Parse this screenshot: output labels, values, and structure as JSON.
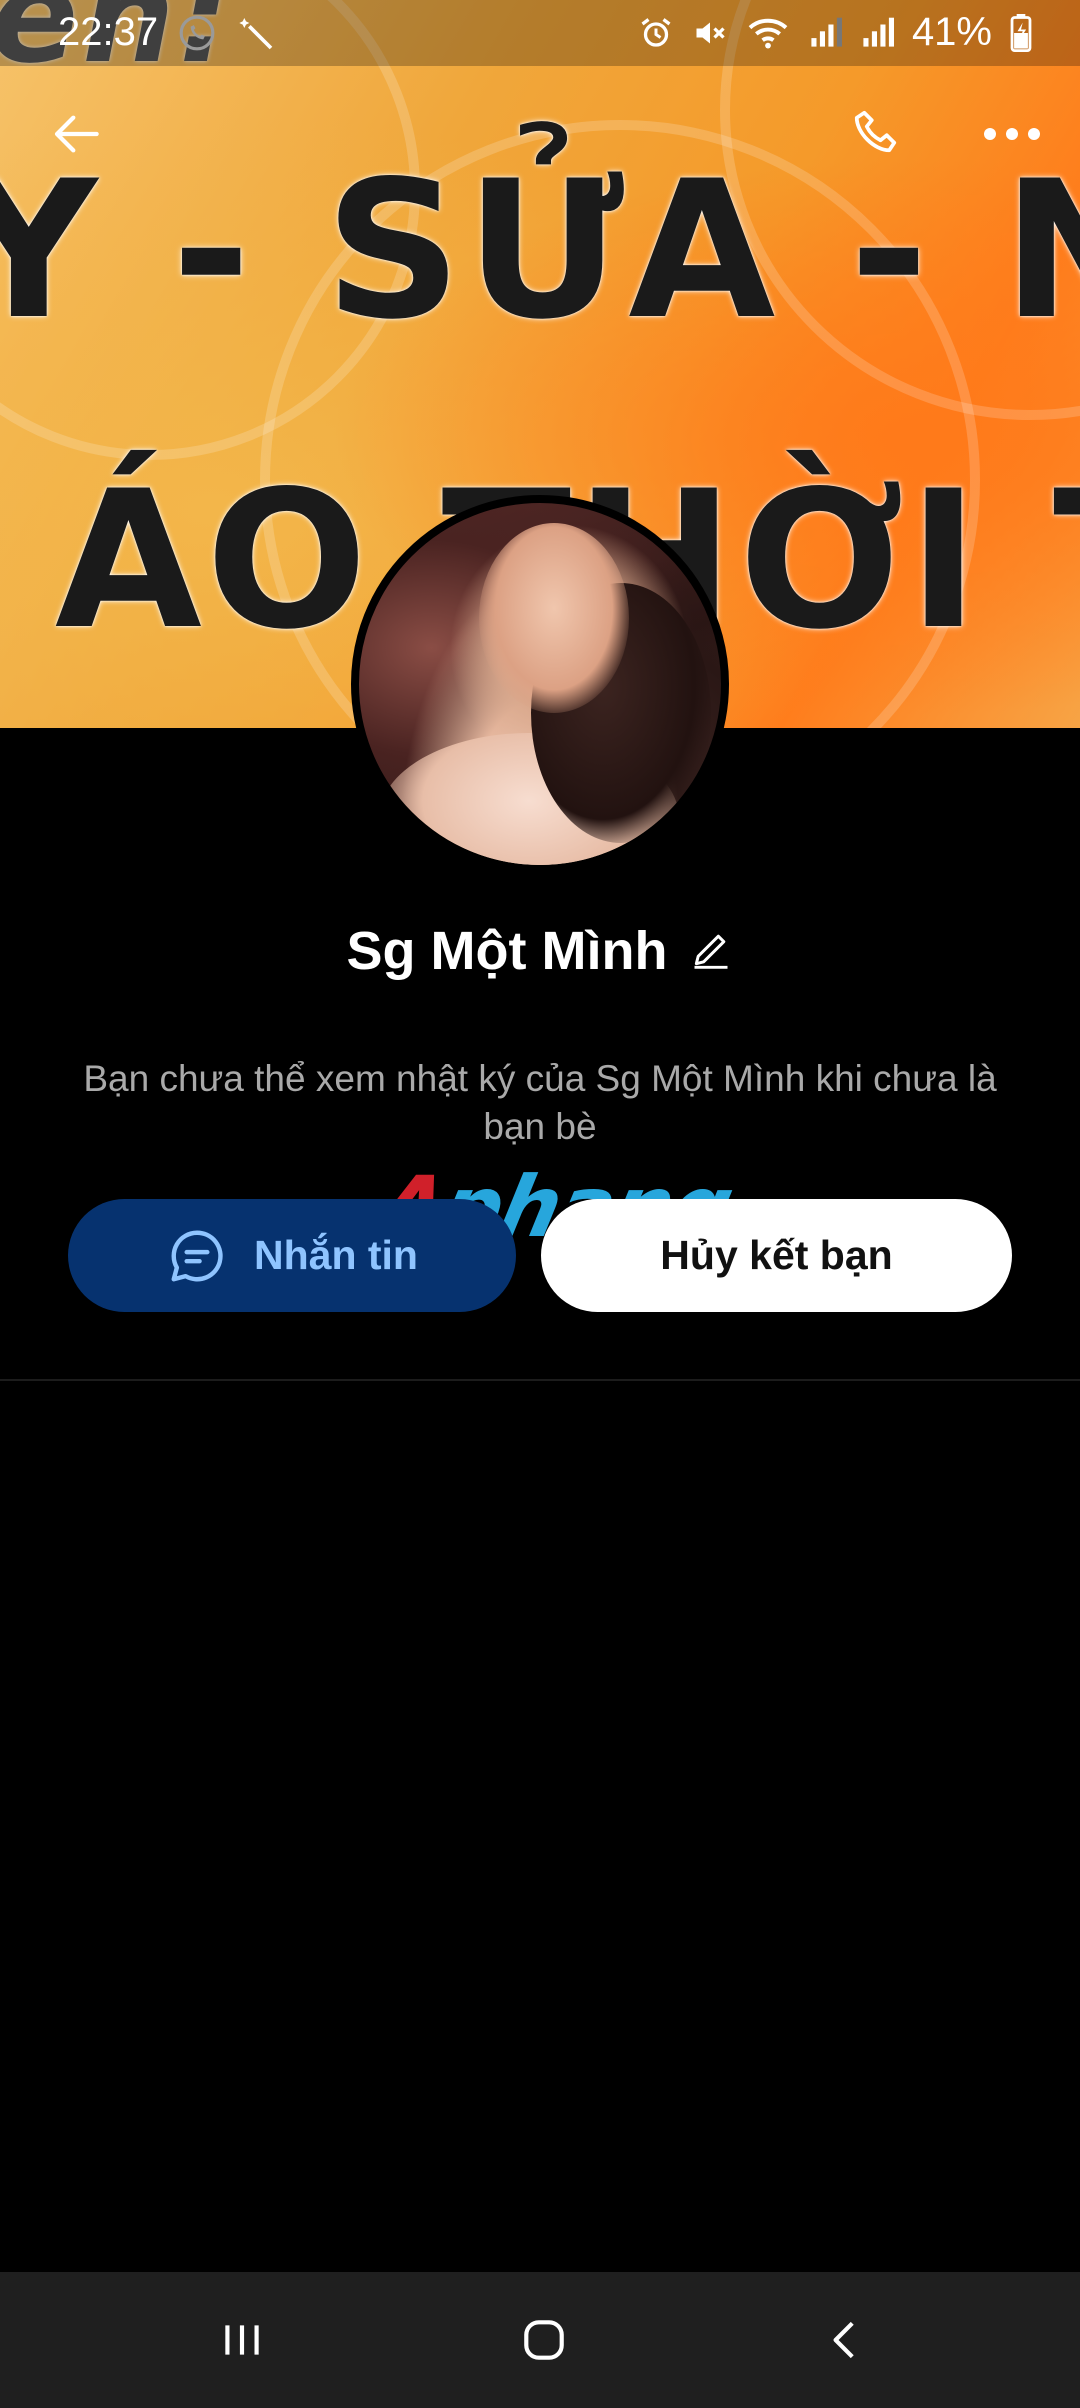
{
  "status_bar": {
    "time": "22:37",
    "battery": "41%",
    "icons": [
      "phone-call-icon",
      "magic-wand-icon",
      "alarm-icon",
      "mute-icon",
      "wifi-icon",
      "signal-icon",
      "signal-icon",
      "battery-icon"
    ]
  },
  "cover": {
    "lines": [
      "en:",
      "Y - SỬA - NHU",
      "I ÁO THỜI T"
    ]
  },
  "top_nav": {
    "back_icon": "arrow-left-icon",
    "call_icon": "phone-icon",
    "more_icon": "more-horizontal-icon"
  },
  "profile": {
    "name": "Sg Một Mình",
    "edit_icon": "pencil-icon",
    "notice": "Bạn chưa thể xem nhật ký của Sg Một Mình khi chưa là bạn bè"
  },
  "watermark": {
    "first": "A",
    "rest": "phang"
  },
  "actions": {
    "message_label": "Nhắn tin",
    "message_icon": "chat-bubble-icon",
    "unfriend_label": "Hủy kết bạn"
  },
  "system_nav": {
    "recents_icon": "recents-icon",
    "home_icon": "home-icon",
    "back_icon": "back-chevron-icon"
  },
  "colors": {
    "message_button_bg": "#06326f",
    "message_button_text": "#8fc4ff",
    "unfriend_button_bg": "#ffffff",
    "background": "#000000"
  }
}
